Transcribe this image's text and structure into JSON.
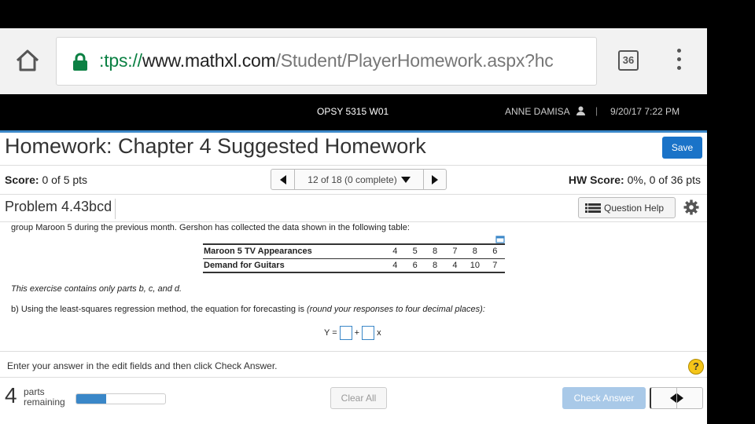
{
  "browser": {
    "url_scheme": ":tps://",
    "url_host": "www.mathxl.com",
    "url_path": "/Student/PlayerHomework.aspx?hc",
    "tab_count": "36"
  },
  "header": {
    "course": "OPSY 5315 W01",
    "user": "ANNE DAMISA",
    "separator": "|",
    "datetime": "9/20/17 7:22 PM"
  },
  "homework": {
    "title": "Homework: Chapter 4 Suggested Homework",
    "save_label": "Save",
    "score_label": "Score:",
    "score_value": "0 of 5 pts",
    "nav_label": "12 of 18 (0 complete)",
    "hw_score_label": "HW Score:",
    "hw_score_value": "0%, 0 of 36 pts",
    "problem_label": "Problem 4.43bcd",
    "question_help_label": "Question Help"
  },
  "content": {
    "intro": "group Maroon 5 during the previous month. Gershon has collected the data shown in the following table:",
    "table": {
      "rows": [
        {
          "label": "Maroon 5 TV Appearances",
          "values": [
            "4",
            "5",
            "8",
            "7",
            "8",
            "6"
          ]
        },
        {
          "label": "Demand for Guitars",
          "values": [
            "4",
            "6",
            "8",
            "4",
            "10",
            "7"
          ]
        }
      ]
    },
    "note": "This exercise contains only parts b, c, and d.",
    "question": "b) Using the least-squares regression method, the equation for forecasting is",
    "question_hint": "(round your responses to four decimal places):",
    "equation": {
      "lhs": "Y =",
      "plus": "+",
      "var": "x"
    }
  },
  "footer": {
    "instruction": "Enter your answer in the edit fields and then click Check Answer.",
    "help_glyph": "?",
    "parts_count": "4",
    "parts_line1": "parts",
    "parts_line2": "remaining",
    "progress_fraction": 0.34,
    "clear_label": "Clear All",
    "check_label": "Check Answer"
  },
  "colors": {
    "accent": "#1a73c8",
    "secure_green": "#0b8043",
    "progress": "#3a87c8"
  }
}
